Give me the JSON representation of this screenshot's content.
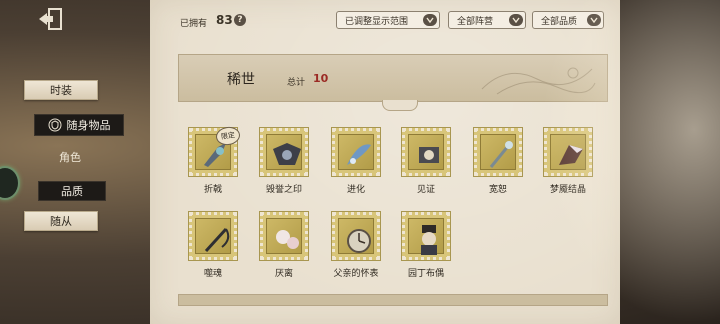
{
  "owned": {
    "label": "已拥有",
    "count": "83",
    "help": "?"
  },
  "filters": [
    {
      "label": "已调整显示范围"
    },
    {
      "label": "全部阵营"
    },
    {
      "label": "全部品质"
    }
  ],
  "nav": {
    "items": [
      {
        "label": "时装"
      },
      {
        "label": "随身物品"
      },
      {
        "label": "角色"
      },
      {
        "label": "品质"
      },
      {
        "label": "随从"
      }
    ]
  },
  "section": {
    "title": "稀世",
    "total_label": "总计",
    "total": "10"
  },
  "items": [
    {
      "name": "折戟",
      "limited": "限定"
    },
    {
      "name": "毁誉之印"
    },
    {
      "name": "进化"
    },
    {
      "name": "见证"
    },
    {
      "name": "宽恕"
    },
    {
      "name": "梦魇结晶"
    },
    {
      "name": "噬魂"
    },
    {
      "name": "厌离"
    },
    {
      "name": "父亲的怀表"
    },
    {
      "name": "园丁布偶"
    }
  ]
}
